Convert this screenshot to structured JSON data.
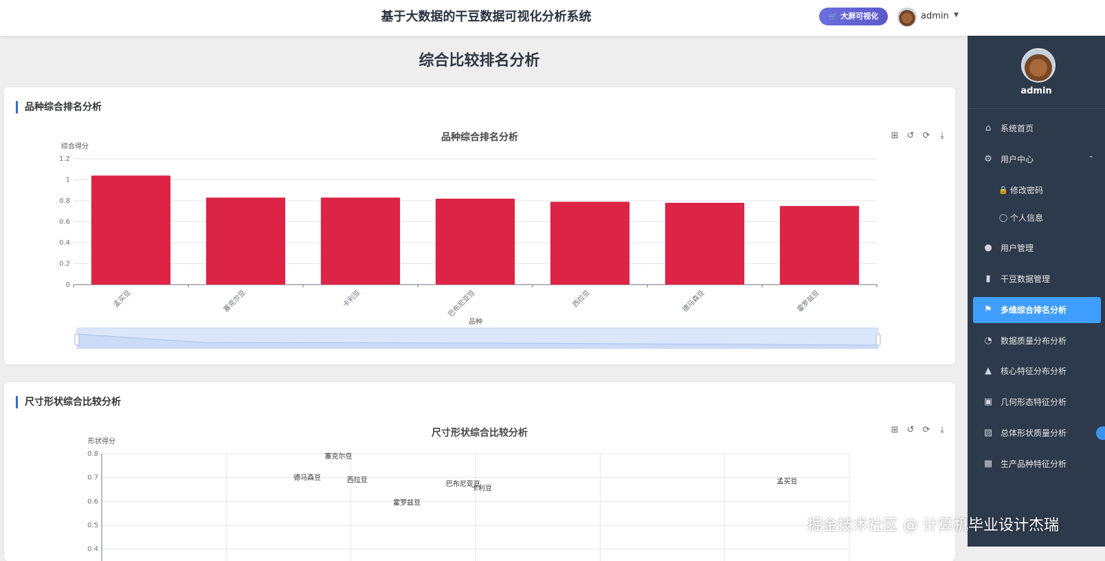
{
  "header": {
    "system_title": "基于大数据的干豆数据可视化分析系统",
    "bigscreen_button": "大屏可视化",
    "username": "admin"
  },
  "sidebar": {
    "username": "admin",
    "items": [
      {
        "label": "系统首页",
        "icon": "home-icon"
      },
      {
        "label": "用户中心",
        "icon": "gear-icon",
        "expanded": true
      },
      {
        "label": "修改密码",
        "icon": "lock-icon",
        "sub": true
      },
      {
        "label": "个人信息",
        "icon": "user-icon",
        "sub": true
      },
      {
        "label": "用户管理",
        "icon": "users-icon"
      },
      {
        "label": "干豆数据管理",
        "icon": "bar-chart-icon"
      },
      {
        "label": "多维综合排名分析",
        "icon": "flag-icon",
        "active": true
      },
      {
        "label": "数据质量分布分析",
        "icon": "pie-icon"
      },
      {
        "label": "核心特征分布分析",
        "icon": "trend-icon"
      },
      {
        "label": "几何形态特征分析",
        "icon": "picture-icon"
      },
      {
        "label": "总体形状质量分析",
        "icon": "clipboard-icon"
      },
      {
        "label": "生产品种特征分析",
        "icon": "grid-icon"
      }
    ],
    "active_color": "#409eff",
    "background": "#2d3a4b"
  },
  "main": {
    "page_title": "综合比较排名分析",
    "card1_title": "品种综合排名分析",
    "card2_title": "尺寸形状综合比较分析"
  },
  "watermark": "掘金技术社区 @ 计算机毕业设计杰瑞",
  "chart_data": [
    {
      "type": "bar",
      "title": "品种综合排名分析",
      "xlabel": "品种",
      "ylabel": "综合得分",
      "categories": [
        "孟买豆",
        "塞克尔豆",
        "卡利豆",
        "巴布尼亚豆",
        "西拉豆",
        "德马森豆",
        "霍罗兹豆"
      ],
      "values": [
        1.04,
        0.83,
        0.83,
        0.82,
        0.79,
        0.78,
        0.75
      ],
      "ylim": [
        0,
        1.2
      ],
      "yticks": [
        "0",
        "0.2",
        "0.4",
        "0.6",
        "0.8",
        "1",
        "1.2"
      ],
      "color": "#dc2446",
      "grid": true,
      "datazoom": true
    },
    {
      "type": "scatter",
      "title": "尺寸形状综合比较分析",
      "ylabel": "形状得分",
      "yticks": [
        "0.4",
        "0.5",
        "0.6",
        "0.7",
        "0.8"
      ],
      "ylim": [
        0.35,
        0.8
      ],
      "points": [
        {
          "label": "塞克尔豆",
          "x": 1.9,
          "y": 0.78
        },
        {
          "label": "德马森豆",
          "x": 1.65,
          "y": 0.69
        },
        {
          "label": "西拉豆",
          "x": 2.05,
          "y": 0.68
        },
        {
          "label": "巴布尼亚豆",
          "x": 2.9,
          "y": 0.665
        },
        {
          "label": "卡利豆",
          "x": 3.05,
          "y": 0.645
        },
        {
          "label": "霍罗兹豆",
          "x": 2.45,
          "y": 0.585
        },
        {
          "label": "孟买豆",
          "x": 5.5,
          "y": 0.675
        }
      ],
      "xlim": [
        0,
        6
      ],
      "grid": true
    }
  ]
}
